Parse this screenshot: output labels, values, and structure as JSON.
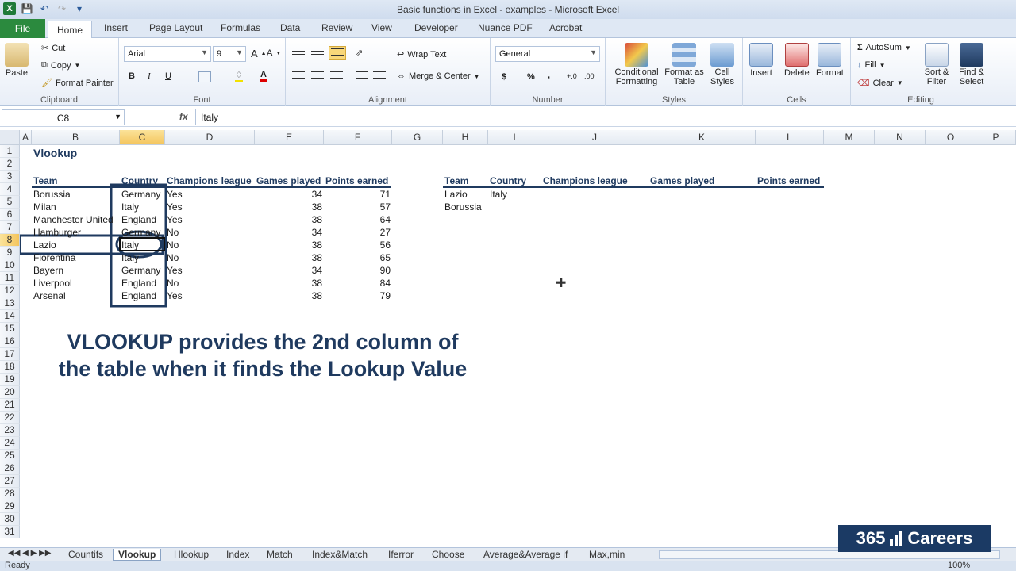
{
  "window": {
    "title": "Basic functions in Excel - examples - Microsoft Excel"
  },
  "tabs": [
    "File",
    "Home",
    "Insert",
    "Page Layout",
    "Formulas",
    "Data",
    "Review",
    "View",
    "Developer",
    "Nuance PDF",
    "Acrobat"
  ],
  "ribbon": {
    "clipboard": {
      "paste": "Paste",
      "cut": "Cut",
      "copy": "Copy",
      "format_painter": "Format Painter",
      "label": "Clipboard"
    },
    "font": {
      "family": "Arial",
      "size": "9",
      "bold": "B",
      "italic": "I",
      "underline": "U",
      "label": "Font"
    },
    "alignment": {
      "wrap_text": "Wrap Text",
      "merge_center": "Merge & Center",
      "label": "Alignment"
    },
    "number": {
      "format": "General",
      "currency": "$",
      "percent": "%",
      "comma": ",",
      "label": "Number"
    },
    "styles": {
      "conditional": "Conditional Formatting",
      "format_table": "Format as Table",
      "cell_styles": "Cell Styles",
      "label": "Styles"
    },
    "cells": {
      "insert": "Insert",
      "delete": "Delete",
      "format": "Format",
      "label": "Cells"
    },
    "editing": {
      "autosum": "AutoSum",
      "fill": "Fill",
      "clear": "Clear",
      "sort_filter": "Sort & Filter",
      "find_select": "Find & Select",
      "label": "Editing"
    }
  },
  "formula_bar": {
    "name_box": "C8",
    "fx": "fx",
    "value": "Italy"
  },
  "columns": [
    "A",
    "B",
    "C",
    "D",
    "E",
    "F",
    "G",
    "H",
    "I",
    "J",
    "K",
    "L",
    "M",
    "N",
    "O",
    "P"
  ],
  "rows": [
    "1",
    "2",
    "3",
    "4",
    "5",
    "6",
    "7",
    "8",
    "9",
    "10",
    "11",
    "12",
    "13",
    "14",
    "15",
    "16",
    "17",
    "18",
    "19",
    "20",
    "21",
    "22",
    "23",
    "24",
    "25",
    "26",
    "27",
    "28",
    "29",
    "30",
    "31"
  ],
  "sheet": {
    "title": "Vlookup",
    "headers": [
      "Team",
      "Country",
      "Champions league",
      "Games played",
      "Points earned"
    ],
    "table": [
      [
        "Borussia",
        "Germany",
        "Yes",
        "34",
        "71"
      ],
      [
        "Milan",
        "Italy",
        "Yes",
        "38",
        "57"
      ],
      [
        "Manchester United",
        "England",
        "Yes",
        "38",
        "64"
      ],
      [
        "Hamburger",
        "Germany",
        "No",
        "34",
        "27"
      ],
      [
        "Lazio",
        "Italy",
        "No",
        "38",
        "56"
      ],
      [
        "Fiorentina",
        "Italy",
        "No",
        "38",
        "65"
      ],
      [
        "Bayern",
        "Germany",
        "Yes",
        "34",
        "90"
      ],
      [
        "Liverpool",
        "England",
        "No",
        "38",
        "84"
      ],
      [
        "Arsenal",
        "England",
        "Yes",
        "38",
        "79"
      ]
    ],
    "lookup_headers": [
      "Team",
      "Country",
      "Champions league",
      "Games played",
      "Points earned"
    ],
    "lookup_rows": [
      [
        "Lazio",
        "Italy"
      ],
      [
        "Borussia",
        ""
      ]
    ],
    "callout_line1": "VLOOKUP provides the 2nd column of",
    "callout_line2": "the table when it finds the Lookup Value"
  },
  "sheet_tabs": [
    "Countifs",
    "Vlookup",
    "Hlookup",
    "Index",
    "Match",
    "Index&Match",
    "Iferror",
    "Choose",
    "Average&Average if",
    "Max,min"
  ],
  "status": {
    "ready": "Ready",
    "zoom": "100%"
  },
  "brand": {
    "number": "365",
    "name": "Careers"
  },
  "colors": {
    "accent": "#1f3a5f",
    "file_tab": "#2b8a3e",
    "selection": "#f4c55e"
  }
}
